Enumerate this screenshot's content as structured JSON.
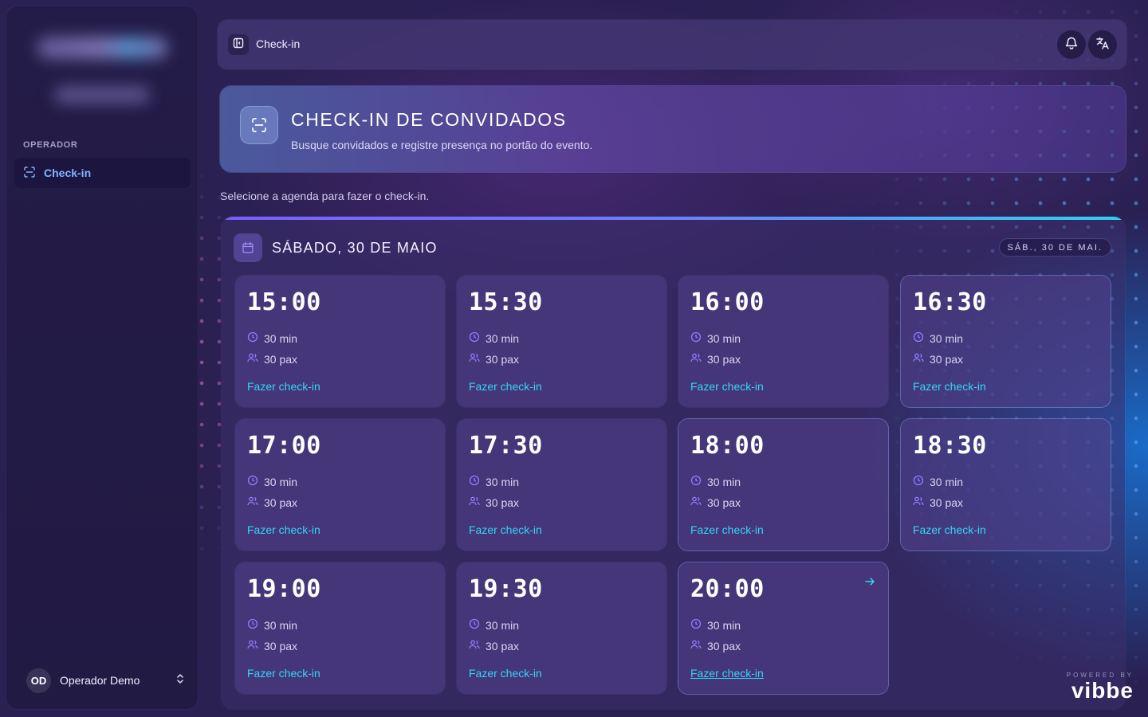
{
  "sidebar": {
    "section_label": "OPERADOR",
    "nav": [
      {
        "label": "Check-in",
        "icon": "scan-icon",
        "active": true
      }
    ],
    "user": {
      "initials": "OD",
      "name": "Operador Demo"
    }
  },
  "topbar": {
    "title": "Check-in",
    "icons": [
      "sidebar-toggle-icon",
      "bell-icon",
      "translate-icon"
    ]
  },
  "hero": {
    "title": "CHECK-IN DE CONVIDADOS",
    "subtitle": "Busque convidados e registre presença no portão do evento."
  },
  "hint": "Selecione a agenda para fazer o check-in.",
  "day": {
    "title": "SÁBADO, 30 DE MAIO",
    "badge": "SÁB., 30 DE MAI.",
    "slots": [
      {
        "time": "15:00",
        "duration": "30 min",
        "pax": "30 pax",
        "action": "Fazer check-in"
      },
      {
        "time": "15:30",
        "duration": "30 min",
        "pax": "30 pax",
        "action": "Fazer check-in"
      },
      {
        "time": "16:00",
        "duration": "30 min",
        "pax": "30 pax",
        "action": "Fazer check-in"
      },
      {
        "time": "16:30",
        "duration": "30 min",
        "pax": "30 pax",
        "action": "Fazer check-in"
      },
      {
        "time": "17:00",
        "duration": "30 min",
        "pax": "30 pax",
        "action": "Fazer check-in"
      },
      {
        "time": "17:30",
        "duration": "30 min",
        "pax": "30 pax",
        "action": "Fazer check-in"
      },
      {
        "time": "18:00",
        "duration": "30 min",
        "pax": "30 pax",
        "action": "Fazer check-in"
      },
      {
        "time": "18:30",
        "duration": "30 min",
        "pax": "30 pax",
        "action": "Fazer check-in"
      },
      {
        "time": "19:00",
        "duration": "30 min",
        "pax": "30 pax",
        "action": "Fazer check-in"
      },
      {
        "time": "19:30",
        "duration": "30 min",
        "pax": "30 pax",
        "action": "Fazer check-in"
      },
      {
        "time": "20:00",
        "duration": "30 min",
        "pax": "30 pax",
        "action": "Fazer check-in"
      }
    ]
  },
  "footer": {
    "powered_by": "POWERED BY",
    "logo": "vibbe"
  },
  "colors": {
    "accent_cyan": "#36d5f5",
    "active_nav": "#7fb4ff",
    "background": "#2a2052"
  }
}
